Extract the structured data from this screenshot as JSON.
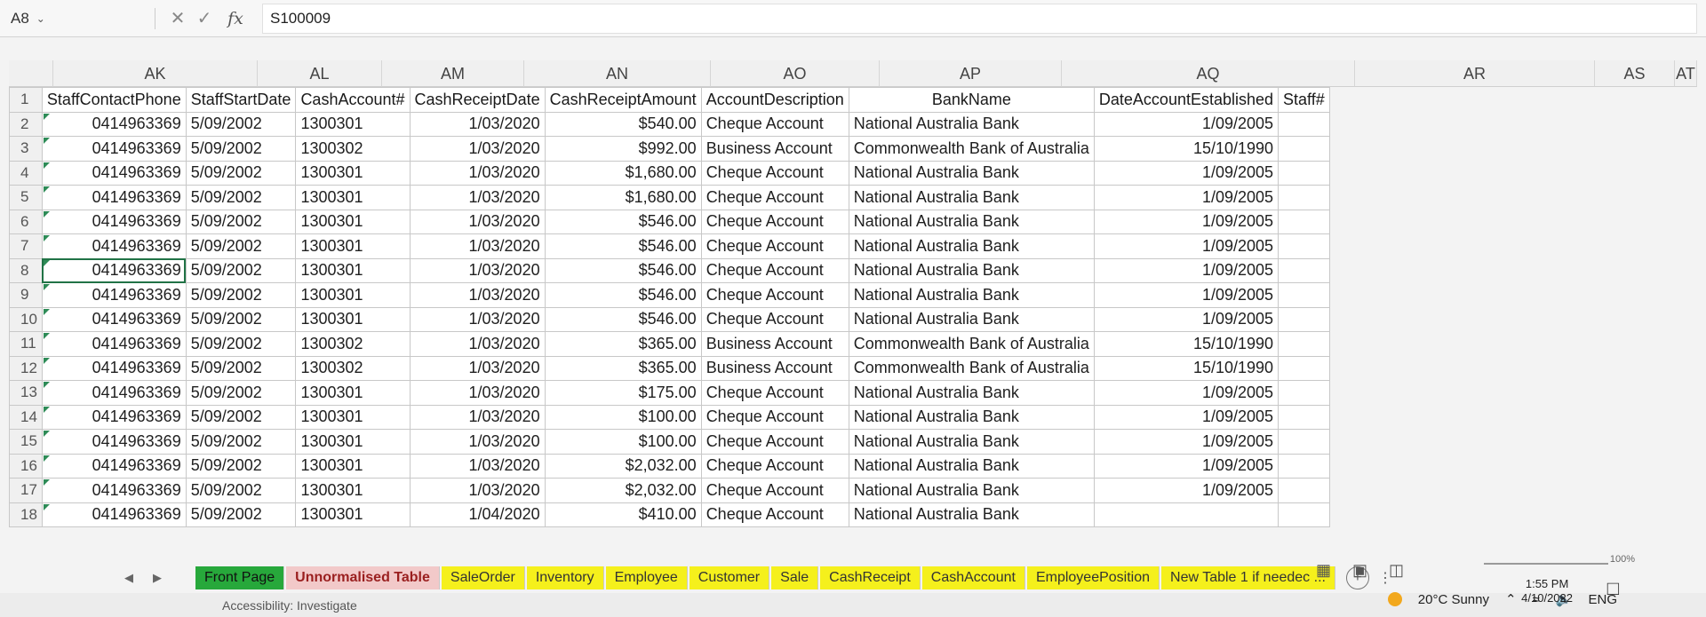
{
  "formula_bar": {
    "name_box": "A8",
    "fx": "fx",
    "value": "S100009"
  },
  "column_letters": [
    "AK",
    "AL",
    "AM",
    "AN",
    "AO",
    "AP",
    "AQ",
    "AR",
    "AS",
    "AT"
  ],
  "headers": [
    "StaffContactPhone",
    "StaffStartDate",
    "CashAccount#",
    "CashReceiptDate",
    "CashReceiptAmount",
    "AccountDescription",
    "BankName",
    "DateAccountEstablished",
    "Staff#"
  ],
  "rows": [
    [
      "2",
      "0414963369",
      "5/09/2002",
      "1300301",
      "1/03/2020",
      "$540.00",
      "Cheque Account",
      "National Australia Bank",
      "1/09/2005",
      ""
    ],
    [
      "3",
      "0414963369",
      "5/09/2002",
      "1300302",
      "1/03/2020",
      "$992.00",
      "Business Account",
      "Commonwealth Bank of Australia",
      "15/10/1990",
      ""
    ],
    [
      "4",
      "0414963369",
      "5/09/2002",
      "1300301",
      "1/03/2020",
      "$1,680.00",
      "Cheque Account",
      "National Australia Bank",
      "1/09/2005",
      ""
    ],
    [
      "5",
      "0414963369",
      "5/09/2002",
      "1300301",
      "1/03/2020",
      "$1,680.00",
      "Cheque Account",
      "National Australia Bank",
      "1/09/2005",
      ""
    ],
    [
      "6",
      "0414963369",
      "5/09/2002",
      "1300301",
      "1/03/2020",
      "$546.00",
      "Cheque Account",
      "National Australia Bank",
      "1/09/2005",
      ""
    ],
    [
      "7",
      "0414963369",
      "5/09/2002",
      "1300301",
      "1/03/2020",
      "$546.00",
      "Cheque Account",
      "National Australia Bank",
      "1/09/2005",
      ""
    ],
    [
      "8",
      "0414963369",
      "5/09/2002",
      "1300301",
      "1/03/2020",
      "$546.00",
      "Cheque Account",
      "National Australia Bank",
      "1/09/2005",
      ""
    ],
    [
      "9",
      "0414963369",
      "5/09/2002",
      "1300301",
      "1/03/2020",
      "$546.00",
      "Cheque Account",
      "National Australia Bank",
      "1/09/2005",
      ""
    ],
    [
      "10",
      "0414963369",
      "5/09/2002",
      "1300301",
      "1/03/2020",
      "$546.00",
      "Cheque Account",
      "National Australia Bank",
      "1/09/2005",
      ""
    ],
    [
      "11",
      "0414963369",
      "5/09/2002",
      "1300302",
      "1/03/2020",
      "$365.00",
      "Business Account",
      "Commonwealth Bank of Australia",
      "15/10/1990",
      ""
    ],
    [
      "12",
      "0414963369",
      "5/09/2002",
      "1300302",
      "1/03/2020",
      "$365.00",
      "Business Account",
      "Commonwealth Bank of Australia",
      "15/10/1990",
      ""
    ],
    [
      "13",
      "0414963369",
      "5/09/2002",
      "1300301",
      "1/03/2020",
      "$175.00",
      "Cheque Account",
      "National Australia Bank",
      "1/09/2005",
      ""
    ],
    [
      "14",
      "0414963369",
      "5/09/2002",
      "1300301",
      "1/03/2020",
      "$100.00",
      "Cheque Account",
      "National Australia Bank",
      "1/09/2005",
      ""
    ],
    [
      "15",
      "0414963369",
      "5/09/2002",
      "1300301",
      "1/03/2020",
      "$100.00",
      "Cheque Account",
      "National Australia Bank",
      "1/09/2005",
      ""
    ],
    [
      "16",
      "0414963369",
      "5/09/2002",
      "1300301",
      "1/03/2020",
      "$2,032.00",
      "Cheque Account",
      "National Australia Bank",
      "1/09/2005",
      ""
    ],
    [
      "17",
      "0414963369",
      "5/09/2002",
      "1300301",
      "1/03/2020",
      "$2,032.00",
      "Cheque Account",
      "National Australia Bank",
      "1/09/2005",
      ""
    ],
    [
      "18",
      "0414963369",
      "5/09/2002",
      "1300301",
      "1/04/2020",
      "$410.00",
      "Cheque Account",
      "National Australia Bank",
      "",
      ""
    ]
  ],
  "tabs": [
    {
      "label": "Front Page",
      "color": "#27a83b"
    },
    {
      "label": "Unnormalised Table",
      "color": "#f2c9c9"
    },
    {
      "label": "SaleOrder",
      "color": "#f5f01c"
    },
    {
      "label": "Inventory",
      "color": "#f5f01c"
    },
    {
      "label": "Employee",
      "color": "#f5f01c"
    },
    {
      "label": "Customer",
      "color": "#f5f01c"
    },
    {
      "label": "Sale",
      "color": "#f5f01c"
    },
    {
      "label": "CashReceipt",
      "color": "#f5f01c"
    },
    {
      "label": "CashAccount",
      "color": "#f5f01c"
    },
    {
      "label": "EmployeePosition",
      "color": "#f5f01c"
    },
    {
      "label": "New Table 1 if needec ...",
      "color": "#f5f01c"
    }
  ],
  "status": {
    "accessibility": "Accessibility: Investigate",
    "zoom": "100%"
  },
  "tray": {
    "weather": "20°C  Sunny",
    "lang": "ENG",
    "time": "1:55 PM",
    "date": "4/10/2022"
  }
}
